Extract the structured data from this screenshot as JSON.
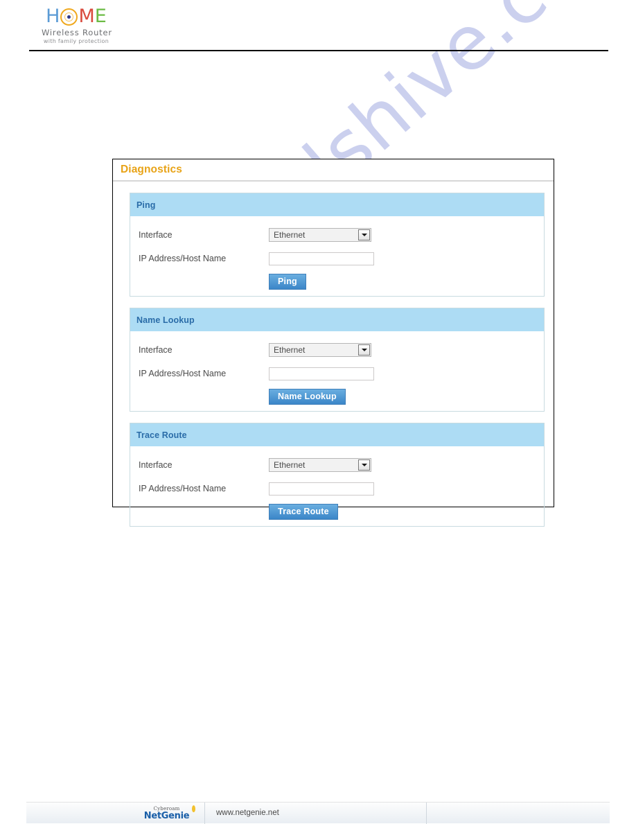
{
  "header": {
    "logo": {
      "word_part1": "H",
      "word_part2": "M",
      "word_part3": "E",
      "ring_icon": "target-ring-icon",
      "subtitle": "Wireless  Router",
      "tagline": "with family protection"
    }
  },
  "watermark": {
    "text": "manualshive.com"
  },
  "panel": {
    "title": "Diagnostics",
    "sections": [
      {
        "id": "ping",
        "title": "Ping",
        "interface_label": "Interface",
        "interface_value": "Ethernet",
        "interface_options": [
          "Ethernet"
        ],
        "host_label": "IP Address/Host Name",
        "host_value": "",
        "host_placeholder": "",
        "button_label": "Ping"
      },
      {
        "id": "name-lookup",
        "title": "Name Lookup",
        "interface_label": "Interface",
        "interface_value": "Ethernet",
        "interface_options": [
          "Ethernet"
        ],
        "host_label": "IP Address/Host Name",
        "host_value": "",
        "host_placeholder": "",
        "button_label": "Name Lookup"
      },
      {
        "id": "trace-route",
        "title": "Trace Route",
        "interface_label": "Interface",
        "interface_value": "Ethernet",
        "interface_options": [
          "Ethernet"
        ],
        "host_label": "IP Address/Host Name",
        "host_value": "",
        "host_placeholder": "",
        "button_label": "Trace Route"
      }
    ]
  },
  "footer": {
    "brand_small": "Cyberoam",
    "brand_main": "NetGenie",
    "url": "www.netgenie.net"
  },
  "colors": {
    "panel_title": "#e8a317",
    "section_header_bg": "#addcf4",
    "section_header_text": "#2a6ca8",
    "button_blue": "#3b86c8",
    "watermark": "#c3c8ec"
  }
}
